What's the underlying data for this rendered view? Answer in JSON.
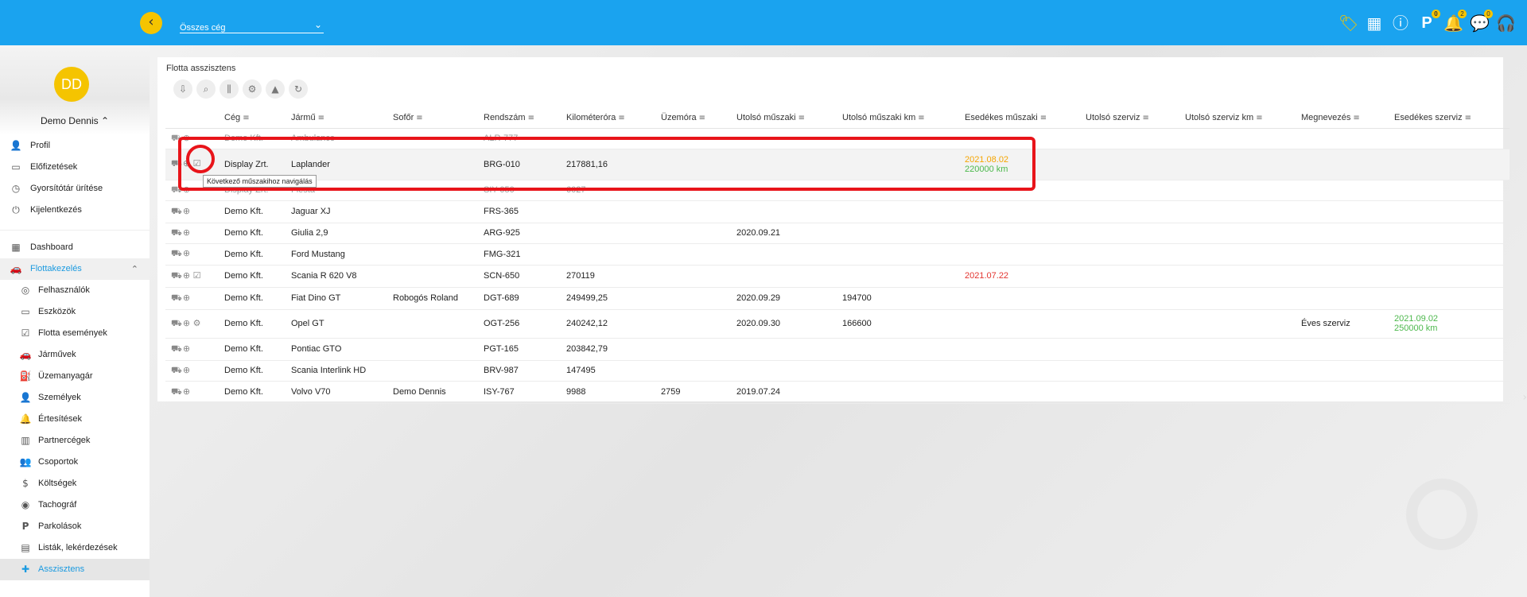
{
  "topbar": {
    "company_select": "Összes cég",
    "badges": {
      "parking": "0",
      "notifications": "2",
      "messages": "0"
    }
  },
  "sidebar": {
    "avatar_initials": "DD",
    "username": "Demo Dennis",
    "profile_menu": [
      "Profil",
      "Előfizetések",
      "Gyorsítótár ürítése",
      "Kijelentkezés"
    ],
    "dashboard": "Dashboard",
    "group": "Flottakezelés",
    "items": [
      "Felhasználók",
      "Eszközök",
      "Flotta események",
      "Járművek",
      "Üzemanyagár",
      "Személyek",
      "Értesítések",
      "Partnercégek",
      "Csoportok",
      "Költségek",
      "Tachográf",
      "Parkolások",
      "Listák, lekérdezések",
      "Asszisztens"
    ]
  },
  "card": {
    "title": "Flotta asszisztens"
  },
  "table": {
    "headers": [
      "Cég",
      "Jármű",
      "Sofőr",
      "Rendszám",
      "Kilométeróra",
      "Üzemóra",
      "Utolsó műszaki",
      "Utolsó műszaki km",
      "Esedékes műszaki",
      "Utolsó szerviz",
      "Utolsó szerviz km",
      "Megnevezés",
      "Esedékes szerviz"
    ],
    "rows": [
      {
        "ceg": "Demo Kft.",
        "jarmu": "Ambulance",
        "sofor": "",
        "rendszam": "ALR-777",
        "km": "",
        "uzemora": "",
        "utolso_muszaki": "",
        "utolso_muszaki_km": "",
        "esedekes_muszaki": "",
        "esedekes_muszaki_km": "",
        "utolso_szerviz": "",
        "utolso_szerviz_km": "",
        "megnevezes": "",
        "esedekes_szerviz": "",
        "esedekes_szerviz_km": ""
      },
      {
        "ceg": "Display Zrt.",
        "jarmu": "Laplander",
        "sofor": "",
        "rendszam": "BRG-010",
        "km": "217881,16",
        "uzemora": "",
        "utolso_muszaki": "",
        "utolso_muszaki_km": "",
        "esedekes_muszaki": "2021.08.02",
        "esedekes_muszaki_km": "220000 km",
        "utolso_szerviz": "",
        "utolso_szerviz_km": "",
        "megnevezes": "",
        "esedekes_szerviz": "",
        "esedekes_szerviz_km": ""
      },
      {
        "ceg": "Display Zrt.",
        "jarmu": "Fiesta",
        "sofor": "",
        "rendszam": "SIY-050",
        "km": "6027",
        "uzemora": "",
        "utolso_muszaki": "",
        "utolso_muszaki_km": "",
        "esedekes_muszaki": "",
        "esedekes_muszaki_km": "",
        "utolso_szerviz": "",
        "utolso_szerviz_km": "",
        "megnevezes": "",
        "esedekes_szerviz": "",
        "esedekes_szerviz_km": ""
      },
      {
        "ceg": "Demo Kft.",
        "jarmu": "Jaguar XJ",
        "sofor": "",
        "rendszam": "FRS-365",
        "km": "",
        "uzemora": "",
        "utolso_muszaki": "",
        "utolso_muszaki_km": "",
        "esedekes_muszaki": "",
        "esedekes_muszaki_km": "",
        "utolso_szerviz": "",
        "utolso_szerviz_km": "",
        "megnevezes": "",
        "esedekes_szerviz": "",
        "esedekes_szerviz_km": ""
      },
      {
        "ceg": "Demo Kft.",
        "jarmu": "Giulia 2,9",
        "sofor": "",
        "rendszam": "ARG-925",
        "km": "",
        "uzemora": "",
        "utolso_muszaki": "2020.09.21",
        "utolso_muszaki_km": "",
        "esedekes_muszaki": "",
        "esedekes_muszaki_km": "",
        "utolso_szerviz": "",
        "utolso_szerviz_km": "",
        "megnevezes": "",
        "esedekes_szerviz": "",
        "esedekes_szerviz_km": ""
      },
      {
        "ceg": "Demo Kft.",
        "jarmu": "Ford Mustang",
        "sofor": "",
        "rendszam": "FMG-321",
        "km": "",
        "uzemora": "",
        "utolso_muszaki": "",
        "utolso_muszaki_km": "",
        "esedekes_muszaki": "",
        "esedekes_muszaki_km": "",
        "utolso_szerviz": "",
        "utolso_szerviz_km": "",
        "megnevezes": "",
        "esedekes_szerviz": "",
        "esedekes_szerviz_km": ""
      },
      {
        "ceg": "Demo Kft.",
        "jarmu": "Scania R 620 V8",
        "sofor": "",
        "rendszam": "SCN-650",
        "km": "270119",
        "uzemora": "",
        "utolso_muszaki": "",
        "utolso_muszaki_km": "",
        "esedekes_muszaki": "2021.07.22",
        "esedekes_muszaki_km": "",
        "utolso_szerviz": "",
        "utolso_szerviz_km": "",
        "megnevezes": "",
        "esedekes_szerviz": "",
        "esedekes_szerviz_km": ""
      },
      {
        "ceg": "Demo Kft.",
        "jarmu": "Fiat Dino GT",
        "sofor": "Robogós Roland",
        "rendszam": "DGT-689",
        "km": "249499,25",
        "uzemora": "",
        "utolso_muszaki": "2020.09.29",
        "utolso_muszaki_km": "194700",
        "esedekes_muszaki": "",
        "esedekes_muszaki_km": "",
        "utolso_szerviz": "",
        "utolso_szerviz_km": "",
        "megnevezes": "",
        "esedekes_szerviz": "",
        "esedekes_szerviz_km": ""
      },
      {
        "ceg": "Demo Kft.",
        "jarmu": "Opel GT",
        "sofor": "",
        "rendszam": "OGT-256",
        "km": "240242,12",
        "uzemora": "",
        "utolso_muszaki": "2020.09.30",
        "utolso_muszaki_km": "166600",
        "esedekes_muszaki": "",
        "esedekes_muszaki_km": "",
        "utolso_szerviz": "",
        "utolso_szerviz_km": "",
        "megnevezes": "Éves szerviz",
        "esedekes_szerviz": "2021.09.02",
        "esedekes_szerviz_km": "250000 km"
      },
      {
        "ceg": "Demo Kft.",
        "jarmu": "Pontiac GTO",
        "sofor": "",
        "rendszam": "PGT-165",
        "km": "203842,79",
        "uzemora": "",
        "utolso_muszaki": "",
        "utolso_muszaki_km": "",
        "esedekes_muszaki": "",
        "esedekes_muszaki_km": "",
        "utolso_szerviz": "",
        "utolso_szerviz_km": "",
        "megnevezes": "",
        "esedekes_szerviz": "",
        "esedekes_szerviz_km": ""
      },
      {
        "ceg": "Demo Kft.",
        "jarmu": "Scania Interlink HD",
        "sofor": "",
        "rendszam": "BRV-987",
        "km": "147495",
        "uzemora": "",
        "utolso_muszaki": "",
        "utolso_muszaki_km": "",
        "esedekes_muszaki": "",
        "esedekes_muszaki_km": "",
        "utolso_szerviz": "",
        "utolso_szerviz_km": "",
        "megnevezes": "",
        "esedekes_szerviz": "",
        "esedekes_szerviz_km": ""
      },
      {
        "ceg": "Demo Kft.",
        "jarmu": "Volvo V70",
        "sofor": "Demo Dennis",
        "rendszam": "ISY-767",
        "km": "9988",
        "uzemora": "2759",
        "utolso_muszaki": "2019.07.24",
        "utolso_muszaki_km": "",
        "esedekes_muszaki": "",
        "esedekes_muszaki_km": "",
        "utolso_szerviz": "",
        "utolso_szerviz_km": "",
        "megnevezes": "",
        "esedekes_szerviz": "",
        "esedekes_szerviz_km": ""
      }
    ]
  },
  "tooltip": "Következő műszakihoz navigálás",
  "colors": {
    "topbar": "#1aa3ef",
    "accent": "#f5c400",
    "highlight": "#e8141a",
    "due_warning": "#f5a500",
    "due_ok": "#4cb84c",
    "overdue": "#e3342f"
  }
}
